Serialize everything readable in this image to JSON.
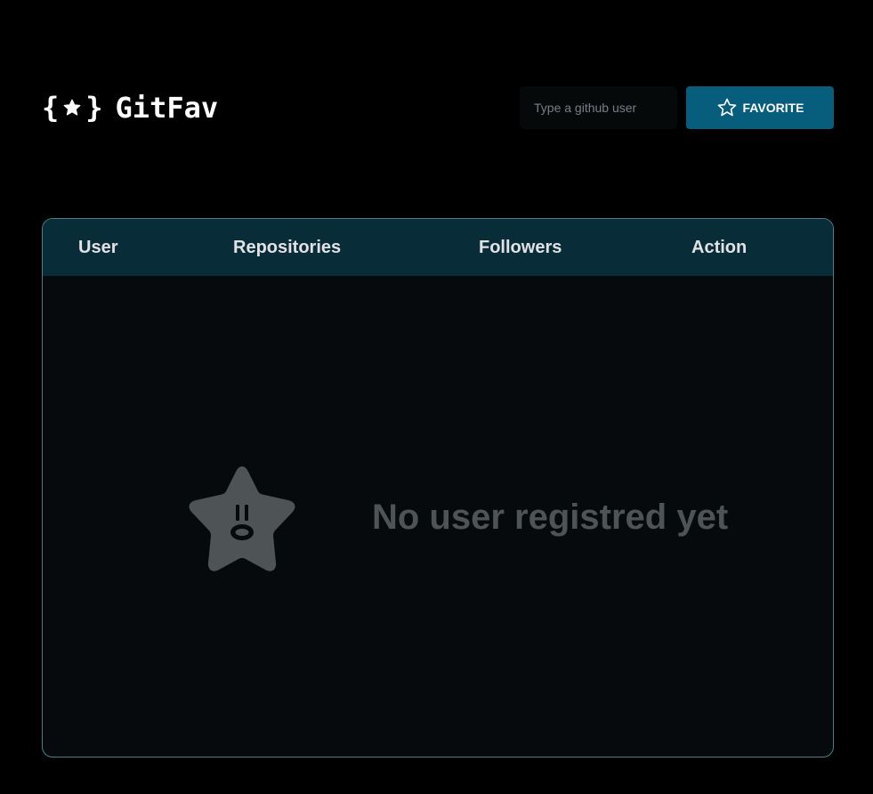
{
  "app": {
    "title": "GitFav",
    "logo_icon": "braces-star-icon"
  },
  "header": {
    "search": {
      "placeholder": "Type a github user",
      "value": ""
    },
    "favorite_button": {
      "label": "FAVORITE",
      "icon": "star-outline-icon"
    }
  },
  "table": {
    "columns": [
      "User",
      "Repositories",
      "Followers",
      "Action"
    ],
    "rows": [],
    "empty_state": {
      "icon": "surprised-star-icon",
      "message": "No user registred yet"
    }
  },
  "colors": {
    "background": "#000000",
    "accent": "#065e7c",
    "header_row": "#092d38",
    "table_body": "#060a0d",
    "border": "#4a808c",
    "empty_text": "#4e5455"
  }
}
